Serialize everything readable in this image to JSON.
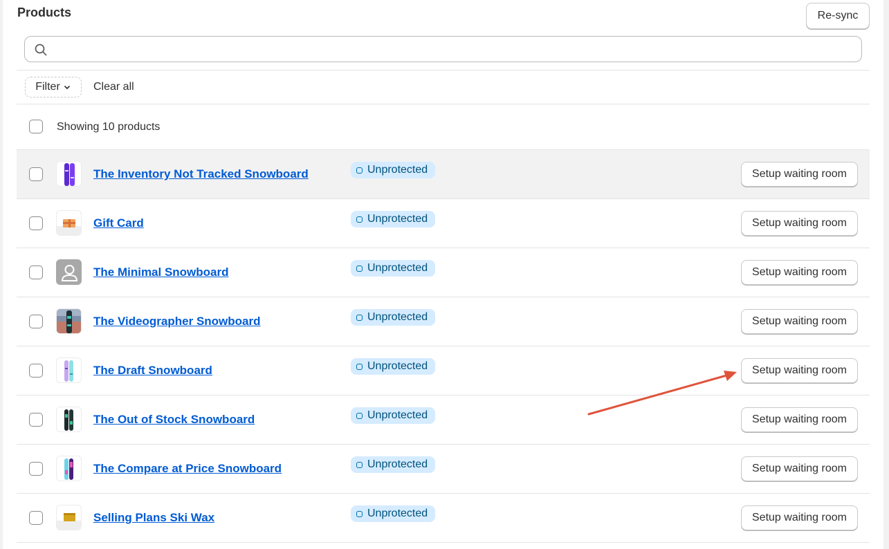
{
  "header": {
    "title": "Products",
    "resync_label": "Re-sync"
  },
  "search": {
    "value": "",
    "placeholder": ""
  },
  "filters": {
    "filter_label": "Filter",
    "clear_label": "Clear all"
  },
  "list": {
    "showing_text": "Showing 10 products",
    "items": [
      {
        "name": "The Inventory Not Tracked Snowboard",
        "status": "Unprotected",
        "action": "Setup waiting room",
        "thumb_icon": "purple-snowboard"
      },
      {
        "name": "Gift Card",
        "status": "Unprotected",
        "action": "Setup waiting room",
        "thumb_icon": "gift-card"
      },
      {
        "name": "The Minimal Snowboard",
        "status": "Unprotected",
        "action": "Setup waiting room",
        "thumb_icon": "placeholder-person"
      },
      {
        "name": "The Videographer Snowboard",
        "status": "Unprotected",
        "action": "Setup waiting room",
        "thumb_icon": "photo-snowboard"
      },
      {
        "name": "The Draft Snowboard",
        "status": "Unprotected",
        "action": "Setup waiting room",
        "thumb_icon": "pastel-snowboard"
      },
      {
        "name": "The Out of Stock Snowboard",
        "status": "Unprotected",
        "action": "Setup waiting room",
        "thumb_icon": "dark-green-snowboard"
      },
      {
        "name": "The Compare at Price Snowboard",
        "status": "Unprotected",
        "action": "Setup waiting room",
        "thumb_icon": "blue-pink-snowboard"
      },
      {
        "name": "Selling Plans Ski Wax",
        "status": "Unprotected",
        "action": "Setup waiting room",
        "thumb_icon": "ski-wax"
      }
    ]
  },
  "colors": {
    "link": "#005bd3",
    "badge_bg": "#d5ebff",
    "badge_text": "#00527c",
    "annotation_arrow": "#e0533b"
  }
}
